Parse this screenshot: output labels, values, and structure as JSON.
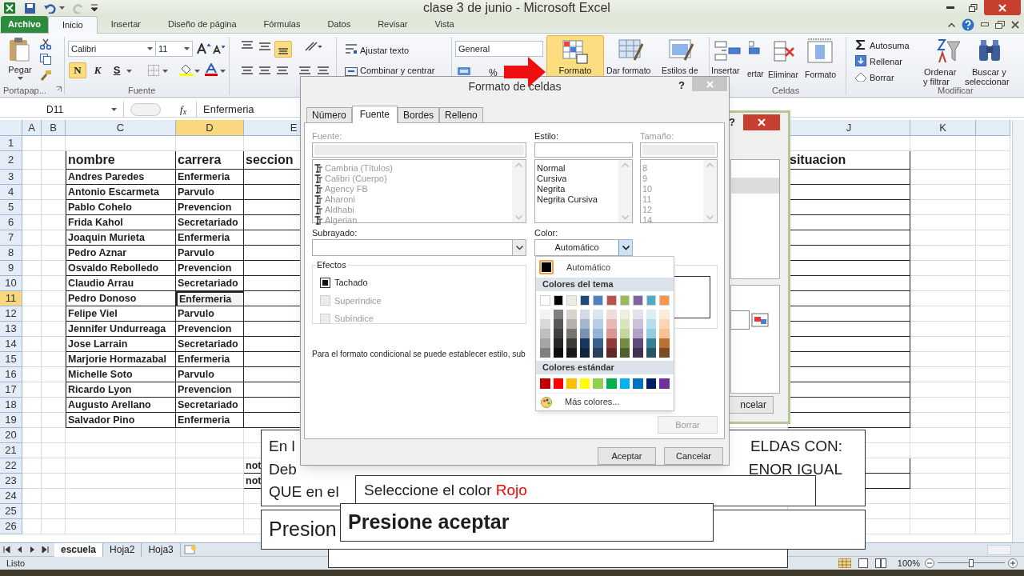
{
  "window": {
    "title": "clase 3 de junio  -  Microsoft Excel"
  },
  "ribbon_tabs": [
    {
      "label": "Archivo",
      "kind": "file",
      "selected": false
    },
    {
      "label": "Inicio",
      "kind": "tab",
      "selected": true
    },
    {
      "label": "Insertar",
      "kind": "tab",
      "selected": false
    },
    {
      "label": "Diseño de página",
      "kind": "tab",
      "selected": false
    },
    {
      "label": "Fórmulas",
      "kind": "tab",
      "selected": false
    },
    {
      "label": "Datos",
      "kind": "tab",
      "selected": false
    },
    {
      "label": "Revisar",
      "kind": "tab",
      "selected": false
    },
    {
      "label": "Vista",
      "kind": "tab",
      "selected": false
    }
  ],
  "ribbon": {
    "clipboard": {
      "label": "Portapap...",
      "paste": "Pegar"
    },
    "font": {
      "label": "Fuente",
      "font_name": "Calibri",
      "font_size": "11",
      "bold": "N",
      "bold_selected": true,
      "italic": "K",
      "underline": "S"
    },
    "alignment": {
      "bottom_selected": true,
      "wrap": "Ajustar texto",
      "merge": "Combinar y centrar"
    },
    "number": {
      "format": "General",
      "percent": "%"
    },
    "styles": {
      "conditional": "Formato",
      "conditional_selected": true,
      "table": "Dar formato",
      "cell_styles": "Estilos de"
    },
    "cells": {
      "label": "Celdas",
      "insert": "Insertar",
      "insert_partial": "ertar",
      "delete": "Eliminar",
      "format": "Formato"
    },
    "editing": {
      "label": "Modificar",
      "autosum": "Autosuma",
      "fill": "Rellenar",
      "clear": "Borrar",
      "sort_1": "Ordenar",
      "sort_2": "y filtrar",
      "find_1": "Buscar y",
      "find_2": "seleccionar"
    }
  },
  "formula_bar": {
    "name_box": "D11",
    "fx": "f$_{x}$",
    "value": "Enfermeria"
  },
  "sheet": {
    "columns": [
      {
        "label": "A",
        "selected": false
      },
      {
        "label": "B",
        "selected": false
      },
      {
        "label": "C",
        "selected": false
      },
      {
        "label": "D",
        "selected": true
      },
      {
        "label": "E",
        "selected": false
      },
      {
        "label": "J",
        "selected": false
      },
      {
        "label": "K",
        "selected": false
      }
    ],
    "row_headers": [
      {
        "label": "1",
        "selected": false
      },
      {
        "label": "2",
        "selected": false
      },
      {
        "label": "3",
        "selected": false
      },
      {
        "label": "4",
        "selected": false
      },
      {
        "label": "5",
        "selected": false
      },
      {
        "label": "6",
        "selected": false
      },
      {
        "label": "7",
        "selected": false
      },
      {
        "label": "8",
        "selected": false
      },
      {
        "label": "9",
        "selected": false
      },
      {
        "label": "10",
        "selected": false
      },
      {
        "label": "11",
        "selected": true
      },
      {
        "label": "12",
        "selected": false
      },
      {
        "label": "13",
        "selected": false
      },
      {
        "label": "14",
        "selected": false
      },
      {
        "label": "15",
        "selected": false
      },
      {
        "label": "16",
        "selected": false
      },
      {
        "label": "17",
        "selected": false
      },
      {
        "label": "18",
        "selected": false
      },
      {
        "label": "19",
        "selected": false
      },
      {
        "label": "20",
        "selected": false
      },
      {
        "label": "21",
        "selected": false
      },
      {
        "label": "22",
        "selected": false
      },
      {
        "label": "23",
        "selected": false
      },
      {
        "label": "24",
        "selected": false
      },
      {
        "label": "25",
        "selected": false
      },
      {
        "label": "26",
        "selected": false
      }
    ],
    "table": {
      "header": [
        "nombre",
        "carrera",
        "seccion"
      ],
      "extra_header": "situacion",
      "rows": [
        {
          "nombre": "Andres Paredes",
          "carrera": "Enfermeria",
          "selected": false
        },
        {
          "nombre": "Antonio Escarmeta",
          "carrera": "Parvulo",
          "selected": false
        },
        {
          "nombre": "Pablo Cohelo",
          "carrera": "Prevencion",
          "selected": false
        },
        {
          "nombre": "Frida Kahol",
          "carrera": "Secretariado",
          "selected": false
        },
        {
          "nombre": "Joaquin Murieta",
          "carrera": "Enfermeria",
          "selected": false
        },
        {
          "nombre": "Pedro Aznar",
          "carrera": "Parvulo",
          "selected": false
        },
        {
          "nombre": "Osvaldo Rebolledo",
          "carrera": "Prevencion",
          "selected": false
        },
        {
          "nombre": "Claudio Arrau",
          "carrera": "Secretariado",
          "selected": false
        },
        {
          "nombre": "Pedro Donoso",
          "carrera": "Enfermeria",
          "selected": true
        },
        {
          "nombre": "Felipe Viel",
          "carrera": "Parvulo",
          "selected": false
        },
        {
          "nombre": "Jennifer Undurreaga",
          "carrera": "Prevencion",
          "selected": false
        },
        {
          "nombre": "Jose Larrain",
          "carrera": "Secretariado",
          "selected": false
        },
        {
          "nombre": "Marjorie Hormazabal",
          "carrera": "Enfermeria",
          "selected": false
        },
        {
          "nombre": "Michelle Soto",
          "carrera": "Parvulo",
          "selected": false
        },
        {
          "nombre": "Ricardo Lyon",
          "carrera": "Prevencion",
          "selected": false
        },
        {
          "nombre": "Augusto Arellano",
          "carrera": "Secretariado",
          "selected": false
        },
        {
          "nombre": "Salvador Pino",
          "carrera": "Enfermeria",
          "selected": false
        }
      ],
      "notes": [
        "not",
        "not"
      ]
    },
    "sheet_tabs": [
      {
        "label": "escuela",
        "selected": true
      },
      {
        "label": "Hoja2",
        "selected": false
      },
      {
        "label": "Hoja3",
        "selected": false
      }
    ]
  },
  "status_bar": {
    "status": "Listo",
    "zoom": "100%",
    "zoom_slider": {
      "level": 0.5
    }
  },
  "back_dialog": {
    "help": "?",
    "cancel": "ncelar"
  },
  "dialog": {
    "title": "Formato de celdas",
    "help": "?",
    "tabs": [
      {
        "label": "Número",
        "selected": false
      },
      {
        "label": "Fuente",
        "selected": true
      },
      {
        "label": "Bordes",
        "selected": false
      },
      {
        "label": "Relleno",
        "selected": false
      }
    ],
    "font": {
      "label": "Fuente:",
      "disabled": true,
      "items": [
        "Cambria (Títulos)",
        "Calibri (Cuerpo)",
        "Agency FB",
        "Aharoni",
        "Aldhabi",
        "Algerian"
      ]
    },
    "style": {
      "label": "Estilo:",
      "disabled": false,
      "items": [
        "Normal",
        "Cursiva",
        "Negrita",
        "Negrita Cursiva"
      ]
    },
    "size": {
      "label": "Tamaño:",
      "disabled": true,
      "items": [
        "8",
        "9",
        "10",
        "11",
        "12",
        "14"
      ]
    },
    "underline_label": "Subrayado:",
    "color_label": "Color:",
    "color_value": "Automático",
    "effects_label": "Efectos",
    "effects": [
      {
        "label": "Tachado",
        "checked": true,
        "disabled": false
      },
      {
        "label": "Superíndice",
        "checked": false,
        "disabled": true
      },
      {
        "label": "Subíndice",
        "checked": false,
        "disabled": true
      }
    ],
    "note": "Para el formato condicional se puede establecer estilo, sub",
    "clear": "Borrar",
    "ok": "Aceptar",
    "cancel": "Cancelar"
  },
  "color_menu": {
    "auto": "Automático",
    "theme_header": "Colores del tema",
    "theme_colors": [
      {
        "color": "#ffffff"
      },
      {
        "color": "#000000"
      },
      {
        "color": "#eeece1"
      },
      {
        "color": "#1f497d"
      },
      {
        "color": "#4f81bd"
      },
      {
        "color": "#c0504d"
      },
      {
        "color": "#9bbb59"
      },
      {
        "color": "#8064a2"
      },
      {
        "color": "#4bacc6"
      },
      {
        "color": "#f79646"
      }
    ],
    "standard_header": "Colores estándar",
    "standard_colors": [
      {
        "color": "#c00000"
      },
      {
        "color": "#ff0000"
      },
      {
        "color": "#ffc000"
      },
      {
        "color": "#ffff00"
      },
      {
        "color": "#92d050"
      },
      {
        "color": "#00b050"
      },
      {
        "color": "#00b0f0"
      },
      {
        "color": "#0070c0"
      },
      {
        "color": "#002060"
      },
      {
        "color": "#7030a0"
      }
    ],
    "more": "Más colores..."
  },
  "callouts": [
    {
      "kind": "split",
      "left_lines": [
        "En l",
        "Deb",
        "QUE en el"
      ],
      "right_lines": [
        "ELDAS CON:",
        "ENOR IGUAL"
      ]
    },
    {
      "kind": "highlight",
      "text": "Seleccione el color",
      "highlight": "Rojo"
    },
    {
      "kind": "large",
      "text": "Presion"
    },
    {
      "kind": "bold",
      "text": "Presione aceptar"
    }
  ]
}
